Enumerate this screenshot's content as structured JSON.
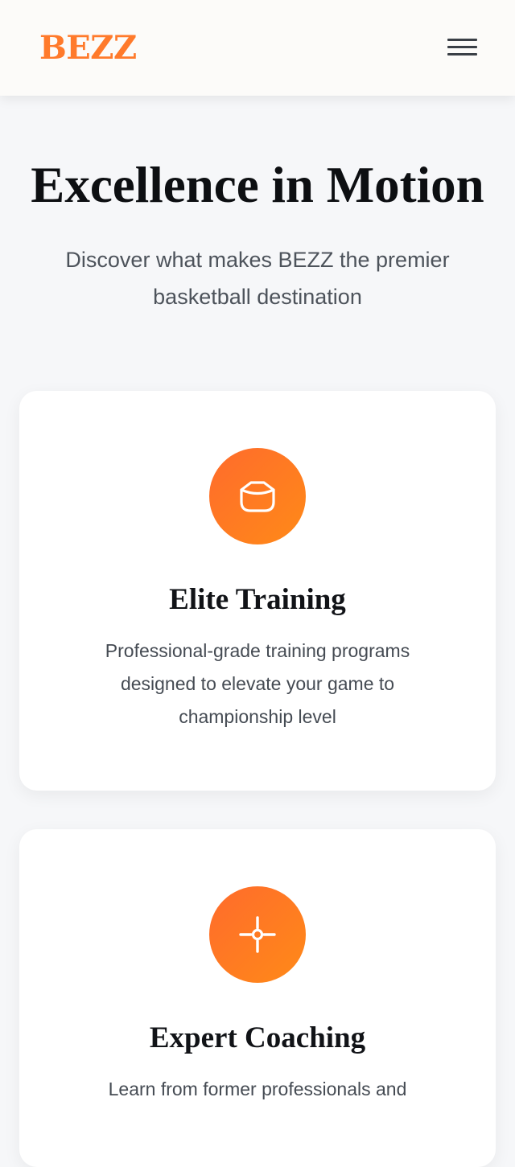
{
  "header": {
    "logo": "BEZZ",
    "menu_icon": "hamburger-menu-icon"
  },
  "hero": {
    "title": "Excellence in Motion",
    "subtitle": "Discover what makes BEZZ the premier basketball destination"
  },
  "features": [
    {
      "icon": "basket-icon",
      "title": "Elite Training",
      "description": "Professional-grade training programs designed to elevate your game to championship level"
    },
    {
      "icon": "crosshair-icon",
      "title": "Expert Coaching",
      "description": "Learn from former professionals and"
    }
  ],
  "colors": {
    "accent": "#ff7a2b",
    "accent_gradient_start": "#ff6b2c",
    "accent_gradient_end": "#ff8a18",
    "background": "#f6f7f9",
    "header_background": "#fcfbf9",
    "card_background": "#ffffff",
    "heading_text": "#0d0f12",
    "body_text": "#4d535b"
  }
}
